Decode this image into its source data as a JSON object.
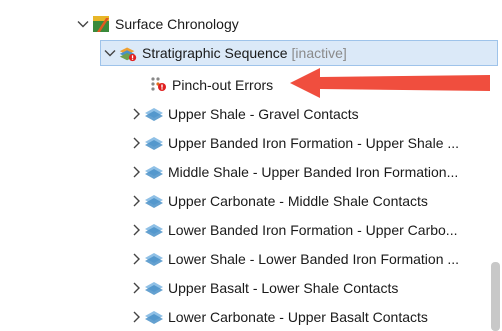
{
  "tree": {
    "root": {
      "label": "Surface Chronology"
    },
    "sequence": {
      "label": "Stratigraphic Sequence",
      "status": "[inactive]"
    },
    "pinch": {
      "label": "Pinch-out Errors"
    },
    "contacts": [
      {
        "label": "Upper Shale - Gravel Contacts"
      },
      {
        "label": "Upper Banded Iron Formation - Upper Shale ..."
      },
      {
        "label": "Middle Shale - Upper Banded Iron Formation..."
      },
      {
        "label": "Upper Carbonate - Middle Shale Contacts"
      },
      {
        "label": "Lower Banded Iron Formation - Upper Carbo..."
      },
      {
        "label": "Lower Shale - Lower Banded Iron Formation ..."
      },
      {
        "label": "Upper Basalt - Lower Shale Contacts"
      },
      {
        "label": "Lower Carbonate - Upper Basalt Contacts"
      }
    ]
  },
  "colors": {
    "selection_bg": "#dbe9f8",
    "selection_border": "#9ec3ea",
    "annotation_arrow": "#f04e3e",
    "inactive_text": "#8a8a8a"
  }
}
